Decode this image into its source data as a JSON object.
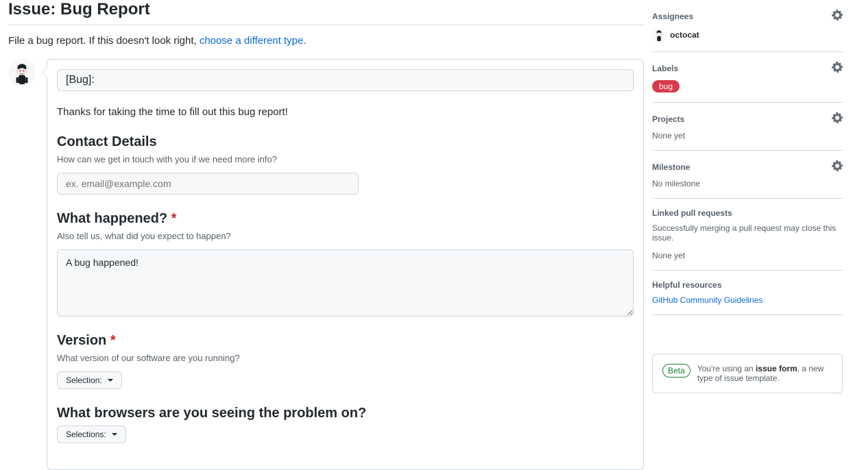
{
  "header": {
    "title": "Issue: Bug Report",
    "intro_text": "File a bug report. If this doesn't look right, ",
    "intro_link": "choose a different type."
  },
  "form": {
    "title_value": "[Bug]: ",
    "thanks_text": "Thanks for taking the time to fill out this bug report!",
    "sections": {
      "contact": {
        "heading": "Contact Details",
        "desc": "How can we get in touch with you if we need more info?",
        "placeholder": "ex. email@example.com",
        "value": ""
      },
      "happened": {
        "heading": "What happened?",
        "desc": "Also tell us, what did you expect to happen?",
        "value": "A bug happened!"
      },
      "version": {
        "heading": "Version",
        "desc": "What version of our software are you running?",
        "button": "Selection:"
      },
      "browsers": {
        "heading": "What browsers are you seeing the problem on?",
        "button": "Selections:"
      }
    }
  },
  "sidebar": {
    "assignees": {
      "title": "Assignees",
      "user": "octocat"
    },
    "labels": {
      "title": "Labels",
      "items": [
        "bug"
      ],
      "color": "#d73a4a"
    },
    "projects": {
      "title": "Projects",
      "empty": "None yet"
    },
    "milestone": {
      "title": "Milestone",
      "empty": "No milestone"
    },
    "linked": {
      "title": "Linked pull requests",
      "desc": "Successfully merging a pull request may close this issue.",
      "empty": "None yet"
    },
    "helpful": {
      "title": "Helpful resources",
      "link": "GitHub Community Guidelines"
    },
    "info": {
      "badge": "Beta",
      "text_pre": "You're using an ",
      "text_strong": "issue form",
      "text_post": ", a new type of issue template."
    }
  }
}
